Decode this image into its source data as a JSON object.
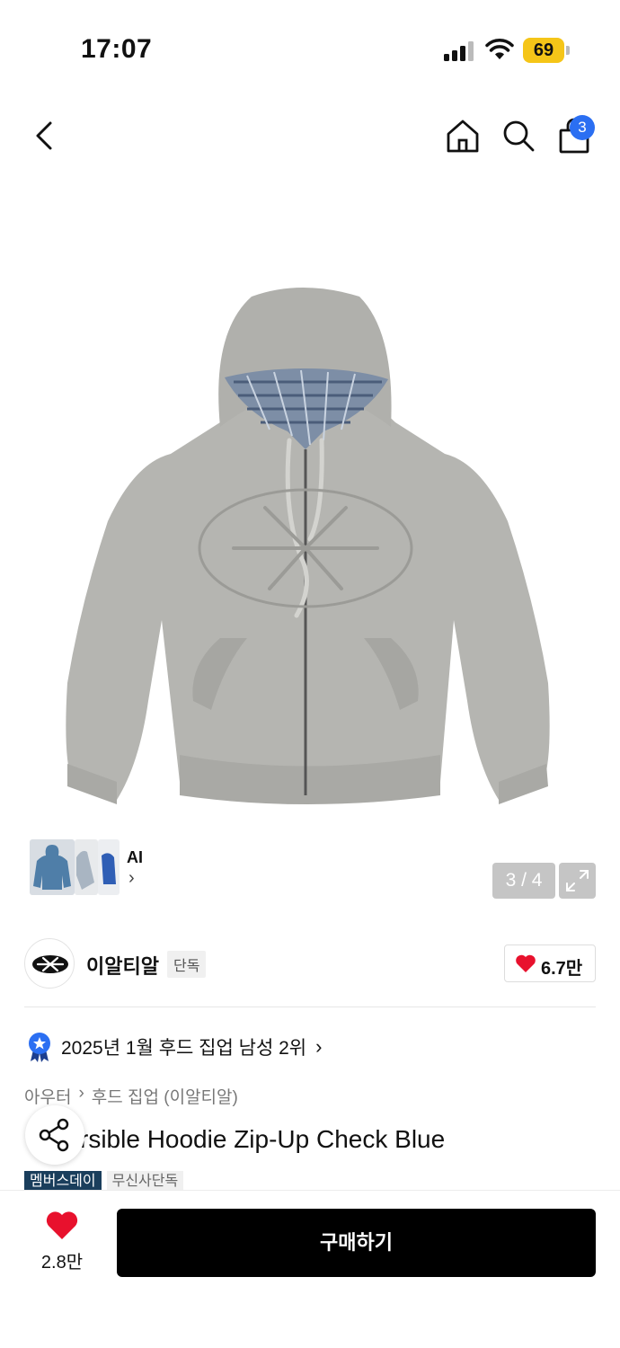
{
  "status_bar": {
    "time": "17:07",
    "battery": "69"
  },
  "header": {
    "cart_count": "3"
  },
  "gallery": {
    "ai_label": "AI",
    "pager": "3 / 4"
  },
  "brand": {
    "name": "이알티알",
    "tag": "단독",
    "like_count": "6.7만"
  },
  "ranking": {
    "text": "2025년 1월 후드 집업 남성 2위"
  },
  "breadcrumb": {
    "category": "아우터",
    "subcategory": "후드 집업 (이알티알)"
  },
  "product": {
    "title_visible": "rsible Hoodie Zip-Up Check Blue"
  },
  "badges": {
    "member": "멤버스데이",
    "exclusive": "무신사단독"
  },
  "bottom": {
    "like_count": "2.8만",
    "buy_label": "구매하기"
  },
  "colors": {
    "accent": "#2b6ff2",
    "heart": "#e8112d",
    "buy_button": "#000000",
    "member_badge": "#1a3e5c"
  }
}
